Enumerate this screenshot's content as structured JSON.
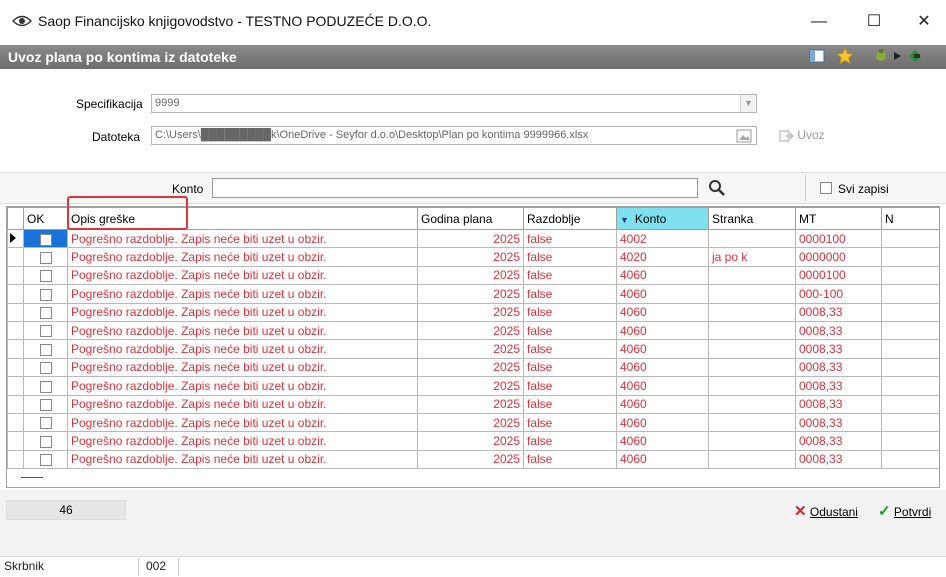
{
  "window": {
    "title": "Saop Financijsko knjigovodstvo - TESTNO PODUZEĆE D.O.O.",
    "minimize": "—",
    "maximize": "☐",
    "close": "✕"
  },
  "form": {
    "title": "Uvoz plana po kontima iz datoteke"
  },
  "fields": {
    "specifikacija_label": "Specifikacija",
    "specifikacija_value": "9999",
    "datoteka_label": "Datoteka",
    "datoteka_value": "C:\\Users\\█████████k\\OneDrive - Seyfor d.o.o\\Desktop\\Plan po kontima 9999966.xlsx",
    "uvoz_label": "Uvoz"
  },
  "search": {
    "konto_label": "Konto",
    "konto_value": "",
    "svi_zapisi_label": "Svi zapisi"
  },
  "grid": {
    "headers": [
      "OK",
      "Opis greške",
      "Godina plana",
      "Razdoblje",
      "Konto",
      "Stranka",
      "MT",
      "N"
    ],
    "rows": [
      {
        "opis": "Pogrešno razdoblje. Zapis neće biti uzet u obzir.",
        "godina": "2025",
        "razdoblje": "false",
        "konto": "4002",
        "stranka": "",
        "mt": "0000100"
      },
      {
        "opis": "Pogrešno razdoblje. Zapis neće biti uzet u obzir.",
        "godina": "2025",
        "razdoblje": "false",
        "konto": "4020",
        "stranka": "ja po k",
        "mt": "0000000"
      },
      {
        "opis": "Pogrešno razdoblje. Zapis neće biti uzet u obzir.",
        "godina": "2025",
        "razdoblje": "false",
        "konto": "4060",
        "stranka": "",
        "mt": "0000100"
      },
      {
        "opis": "Pogrešno razdoblje. Zapis neće biti uzet u obzir.",
        "godina": "2025",
        "razdoblje": "false",
        "konto": "4060",
        "stranka": "",
        "mt": "000-100"
      },
      {
        "opis": "Pogrešno razdoblje. Zapis neće biti uzet u obzir.",
        "godina": "2025",
        "razdoblje": "false",
        "konto": "4060",
        "stranka": "",
        "mt": "0008,33"
      },
      {
        "opis": "Pogrešno razdoblje. Zapis neće biti uzet u obzir.",
        "godina": "2025",
        "razdoblje": "false",
        "konto": "4060",
        "stranka": "",
        "mt": "0008,33"
      },
      {
        "opis": "Pogrešno razdoblje. Zapis neće biti uzet u obzir.",
        "godina": "2025",
        "razdoblje": "false",
        "konto": "4060",
        "stranka": "",
        "mt": "0008,33"
      },
      {
        "opis": "Pogrešno razdoblje. Zapis neće biti uzet u obzir.",
        "godina": "2025",
        "razdoblje": "false",
        "konto": "4060",
        "stranka": "",
        "mt": "0008,33"
      },
      {
        "opis": "Pogrešno razdoblje. Zapis neće biti uzet u obzir.",
        "godina": "2025",
        "razdoblje": "false",
        "konto": "4060",
        "stranka": "",
        "mt": "0008,33"
      },
      {
        "opis": "Pogrešno razdoblje. Zapis neće biti uzet u obzir.",
        "godina": "2025",
        "razdoblje": "false",
        "konto": "4060",
        "stranka": "",
        "mt": "0008,33"
      },
      {
        "opis": "Pogrešno razdoblje. Zapis neće biti uzet u obzir.",
        "godina": "2025",
        "razdoblje": "false",
        "konto": "4060",
        "stranka": "",
        "mt": "0008,33"
      },
      {
        "opis": "Pogrešno razdoblje. Zapis neće biti uzet u obzir.",
        "godina": "2025",
        "razdoblje": "false",
        "konto": "4060",
        "stranka": "",
        "mt": "0008,33"
      },
      {
        "opis": "Pogrešno razdoblje. Zapis neće biti uzet u obzir.",
        "godina": "2025",
        "razdoblje": "false",
        "konto": "4060",
        "stranka": "",
        "mt": "0008,33"
      }
    ]
  },
  "footer": {
    "record_count": "46",
    "odustani_label": "Odustani",
    "potvrdi_label": "Potvrdi",
    "status_user": "Skrbnik",
    "status_code": "002"
  },
  "colors": {
    "error_text": "#e0303a",
    "header_gray": "#7a7a7a",
    "sorted_column": "#7fe0ef",
    "highlight": "#e0353a"
  }
}
